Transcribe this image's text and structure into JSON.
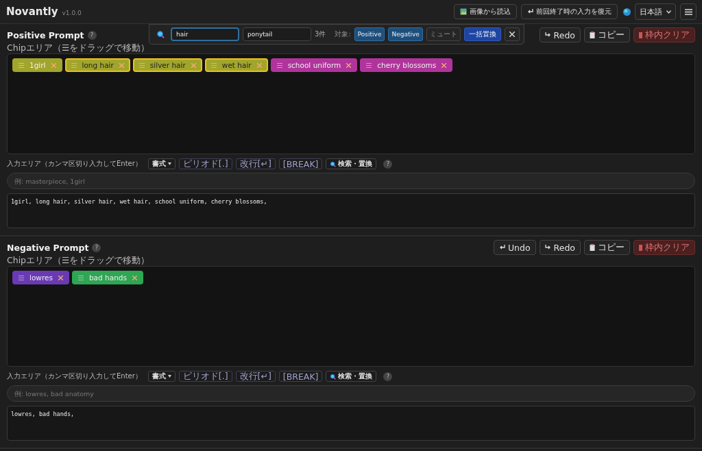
{
  "app": {
    "title": "Novantly",
    "version": "v1.0.0"
  },
  "header_buttons": [
    {
      "kind": "image",
      "label": "画像から読込"
    },
    {
      "kind": "restore",
      "label": "前回終了時の入力を復元"
    }
  ],
  "language": "日本語",
  "search_bar": {
    "query": "hair",
    "replacement": "ponytail",
    "count": "3件",
    "target_label": "対象:",
    "targets": [
      {
        "label": "Positive",
        "selected": true
      },
      {
        "label": "Negative",
        "selected": true
      },
      {
        "label": "ミュート",
        "selected": false
      }
    ],
    "replace_all": "一括置換"
  },
  "sections": [
    {
      "title": "Positive Prompt",
      "help": "?",
      "actions": [
        {
          "kind": "redo",
          "label": "Redo"
        },
        {
          "kind": "copy",
          "label": "コピー"
        },
        {
          "kind": "clear",
          "label": "枠内クリア"
        }
      ],
      "chip_area_label": "Chipエリア（☰をドラッグで移動）",
      "chips": [
        {
          "label": "1girl",
          "color": "#a2a52c",
          "matched": false
        },
        {
          "label": "long hair",
          "color": "#a2a52c",
          "matched": true
        },
        {
          "label": "silver hair",
          "color": "#a2a52c",
          "matched": true
        },
        {
          "label": "wet hair",
          "color": "#a2a52c",
          "matched": true
        },
        {
          "label": "school uniform",
          "color": "#b0349c",
          "matched": false
        },
        {
          "label": "cherry blossoms",
          "color": "#b0349c",
          "matched": false
        }
      ],
      "input_label": "入力エリア（カンマ区切り入力してEnter）",
      "tools": [
        {
          "kind": "format",
          "label": "書式"
        },
        {
          "kind": "plain",
          "label": "ピリオド[.]"
        },
        {
          "kind": "plain",
          "label": "改行[↵]"
        },
        {
          "kind": "plain",
          "label": "[BREAK]"
        },
        {
          "kind": "search",
          "label": "検索・置換"
        }
      ],
      "input_help": "?",
      "placeholder": "例: masterpiece, 1girl",
      "text": "1girl, long hair, silver hair, wet hair, school uniform, cherry blossoms,"
    },
    {
      "title": "Negative Prompt",
      "help": "?",
      "actions": [
        {
          "kind": "undo",
          "label": "Undo"
        },
        {
          "kind": "redo",
          "label": "Redo"
        },
        {
          "kind": "copy",
          "label": "コピー"
        },
        {
          "kind": "clear",
          "label": "枠内クリア"
        }
      ],
      "chip_area_label": "Chipエリア（☰をドラッグで移動）",
      "chips": [
        {
          "label": "lowres",
          "color": "#6a3ab4",
          "matched": false
        },
        {
          "label": "bad hands",
          "color": "#2ea653",
          "matched": false
        }
      ],
      "input_label": "入力エリア（カンマ区切り入力してEnter）",
      "tools": [
        {
          "kind": "format",
          "label": "書式"
        },
        {
          "kind": "plain",
          "label": "ピリオド[.]"
        },
        {
          "kind": "plain",
          "label": "改行[↵]"
        },
        {
          "kind": "plain",
          "label": "[BREAK]"
        },
        {
          "kind": "search",
          "label": "検索・置換"
        }
      ],
      "input_help": "?",
      "placeholder": "例: lowres, bad anatomy",
      "text": "lowres, bad hands,"
    }
  ]
}
